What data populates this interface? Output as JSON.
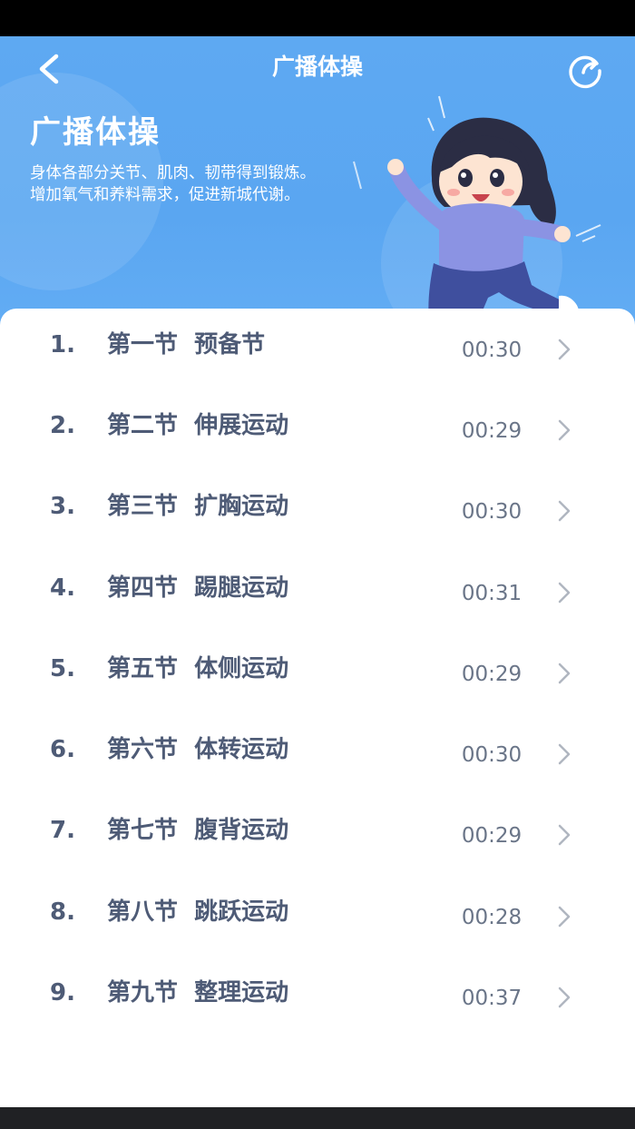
{
  "nav": {
    "title": "广播体操",
    "back_icon": "chevron-left-icon",
    "share_icon": "share-icon"
  },
  "hero": {
    "heading": "广播体操",
    "desc_line1": "身体各部分关节、肌肉、韧带得到锻炼。",
    "desc_line2": "增加氧气和养料需求，促进新城代谢。",
    "illustration": "jumping-girl-illustration"
  },
  "colors": {
    "hero_bg": "#5aa6f1",
    "text_primary": "#4e5b76",
    "text_secondary": "#6a7588",
    "chevron": "#b0b6c0"
  },
  "sections": [
    {
      "num": "1.",
      "title": "第一节  预备节",
      "duration": "00:30"
    },
    {
      "num": "2.",
      "title": "第二节  伸展运动",
      "duration": "00:29"
    },
    {
      "num": "3.",
      "title": "第三节  扩胸运动",
      "duration": "00:30"
    },
    {
      "num": "4.",
      "title": "第四节  踢腿运动",
      "duration": "00:31"
    },
    {
      "num": "5.",
      "title": "第五节  体侧运动",
      "duration": "00:29"
    },
    {
      "num": "6.",
      "title": "第六节  体转运动",
      "duration": "00:30"
    },
    {
      "num": "7.",
      "title": "第七节  腹背运动",
      "duration": "00:29"
    },
    {
      "num": "8.",
      "title": "第八节  跳跃运动",
      "duration": "00:28"
    },
    {
      "num": "9.",
      "title": "第九节  整理运动",
      "duration": "00:37"
    }
  ]
}
